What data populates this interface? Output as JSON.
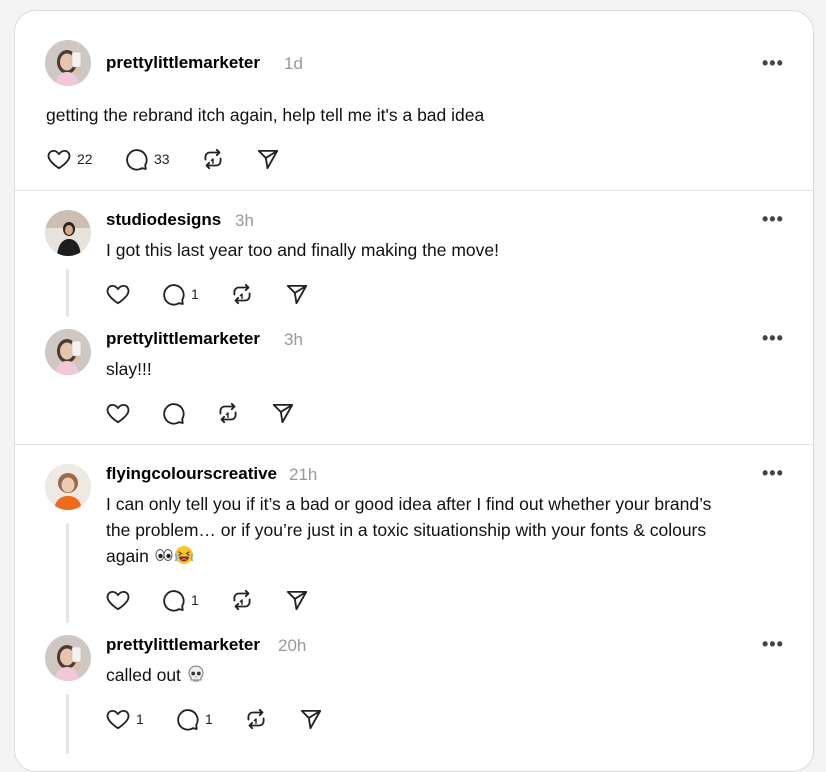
{
  "main_post": {
    "username": "prettylittlemarketer",
    "time": "1d",
    "text": "getting the rebrand itch again, help tell me it's a bad idea",
    "likes": "22",
    "comments": "33"
  },
  "replies": [
    {
      "username": "studiodesigns",
      "time": "3h",
      "text": "I got this last year too and finally making the move!",
      "likes": "",
      "comments": "1"
    },
    {
      "username": "prettylittlemarketer",
      "time": "3h",
      "text": "slay!!!",
      "likes": "",
      "comments": ""
    },
    {
      "username": "flyingcolourscreative",
      "time": "21h",
      "text_lines": [
        "I can only tell you if it’s a bad or good idea after I find out whether your brand’s",
        "the problem… or if you’re just in a toxic situationship with your fonts & colours",
        "again"
      ],
      "likes": "",
      "comments": "1"
    },
    {
      "username": "prettylittlemarketer",
      "time": "20h",
      "text": "called out",
      "likes": "1",
      "comments": "1"
    }
  ],
  "more_label": "•••",
  "icons": {
    "like": "heart-icon",
    "comment": "comment-icon",
    "repost": "repost-icon",
    "share": "send-icon",
    "more": "more-icon"
  }
}
